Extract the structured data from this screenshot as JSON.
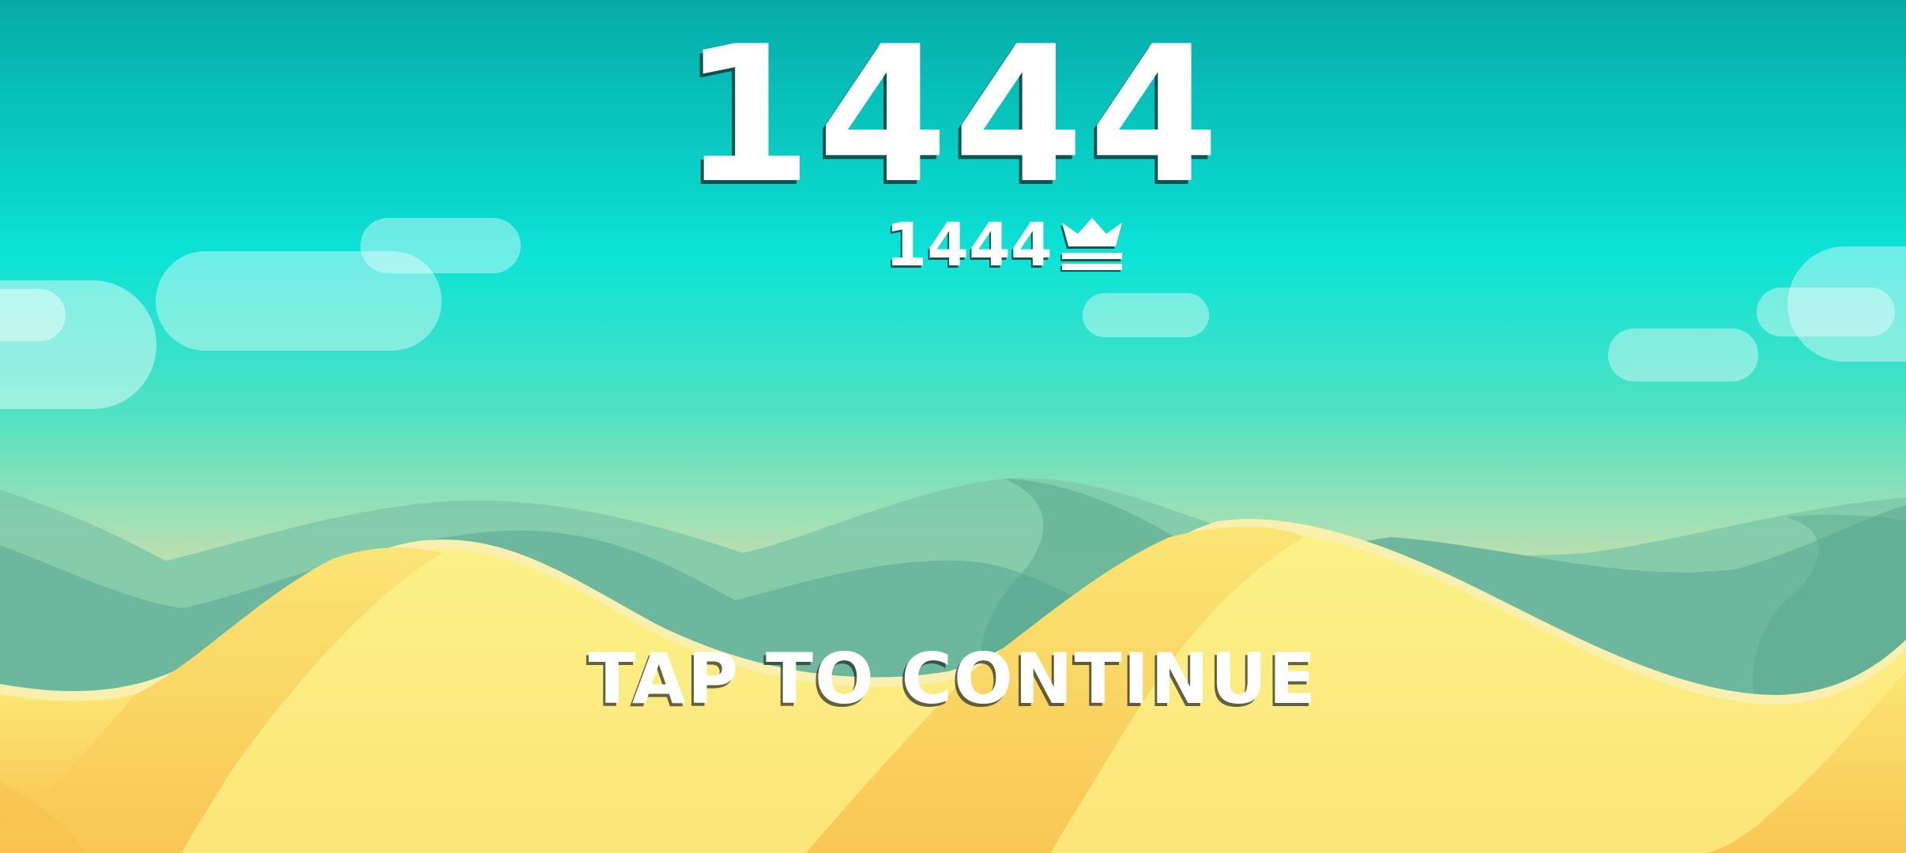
{
  "game": {
    "score": "1444",
    "best_score": "1444",
    "prompt": "TAP TO CONTINUE"
  },
  "icons": {
    "best_score_icon": "crown-icon"
  },
  "colors": {
    "sky_top": "#05aaa8",
    "sky_mid": "#0ce3d6",
    "sky_horizon": "#b8dfb0",
    "dune_light": "#fbf287",
    "dune_shade": "#fbd45e",
    "dune_rim": "#f9f0b0",
    "hills_back": "#7ec9a9",
    "hills_front": "#6cb79e",
    "text": "#ffffff"
  }
}
